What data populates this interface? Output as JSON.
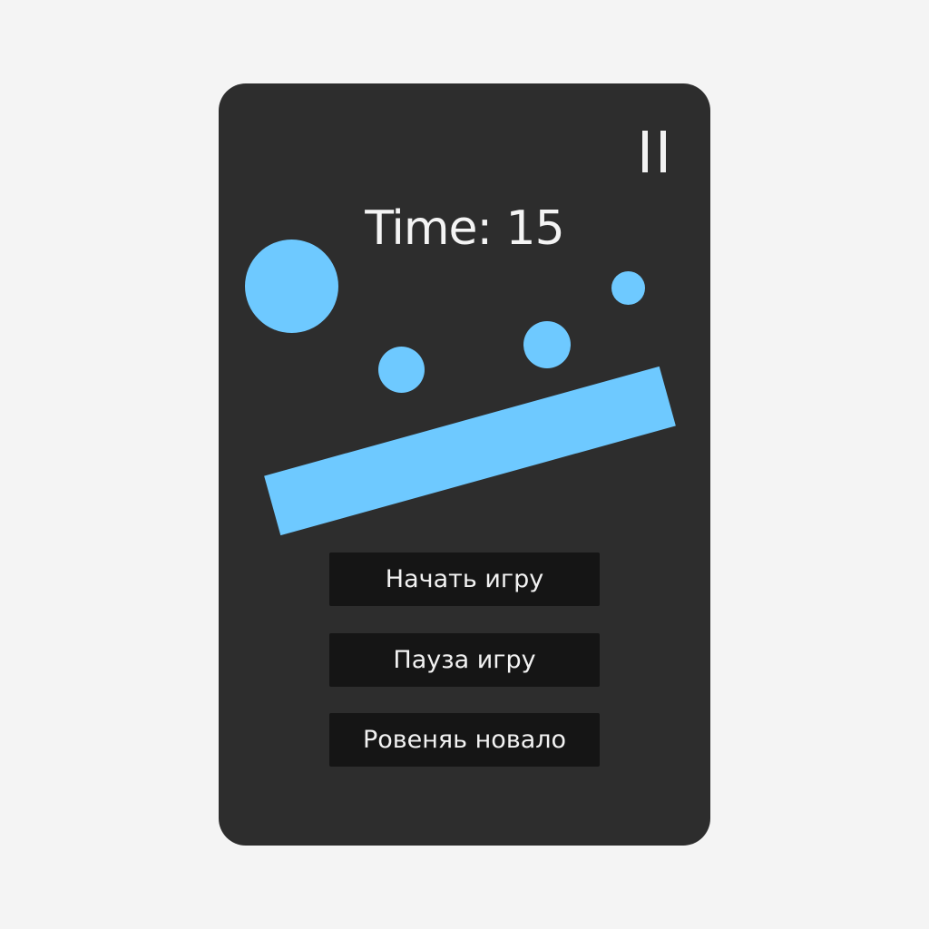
{
  "game": {
    "timer_label": "Time: 15",
    "pause_icon": "pause-icon",
    "accent_color": "#6ec9ff",
    "background_color": "#2d2d2d"
  },
  "menu": {
    "start_label": "Начать игру",
    "pause_label": "Пауза игру",
    "restart_label": "Ровеняь новало"
  }
}
